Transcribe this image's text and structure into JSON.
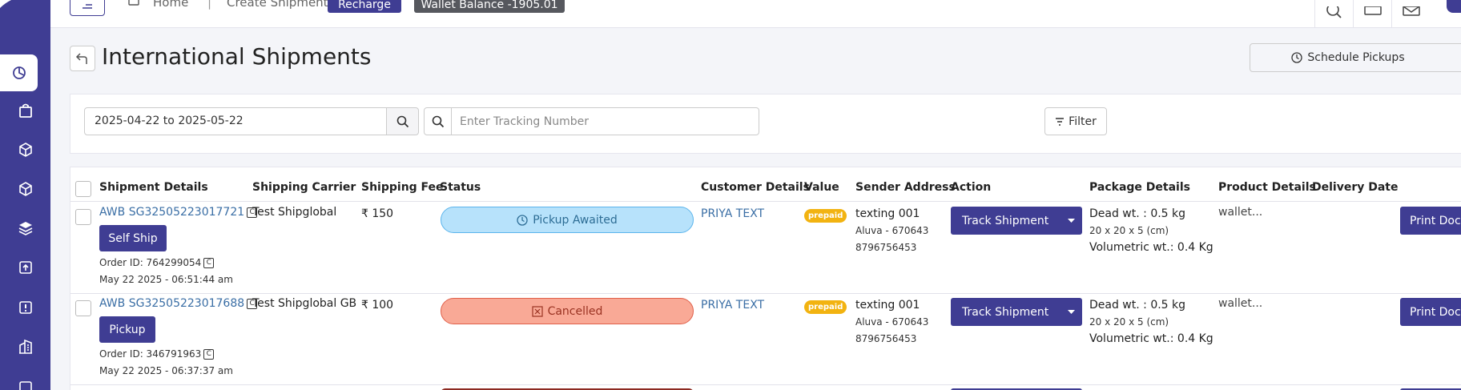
{
  "topbar": {
    "home": "Home",
    "separator": "|",
    "create_shipment": "Create Shipment",
    "recharge": "Recharge",
    "wallet_balance": "Wallet Balance -1905.01"
  },
  "page": {
    "title": "International Shipments",
    "schedule_pickups": "Schedule Pickups"
  },
  "filters": {
    "date_range": "2025-04-22 to 2025-05-22",
    "tracking_placeholder": "Enter Tracking Number",
    "filter_label": "Filter"
  },
  "table": {
    "headers": {
      "shipment": "Shipment Details",
      "carrier": "Shipping Carrier",
      "fee": "Shipping Fee",
      "status": "Status",
      "customer": "Customer Details",
      "value": "Value",
      "sender": "Sender Address",
      "action": "Action",
      "package": "Package Details",
      "product": "Product Details",
      "delivery": "Delivery Date"
    },
    "rows": [
      {
        "awb": "AWB SG32505223017721",
        "ship_btn": "Self Ship",
        "order_id": "Order ID: 764299054",
        "date": "May 22 2025 - 06:51:44 am",
        "carrier": "Test Shipglobal",
        "fee": "₹ 150",
        "status": "Pickup Awaited",
        "customer": "PRIYA TEXT",
        "value_badge": "prepaid",
        "sender_name": "texting 001",
        "sender_city": "Aluva - 670643",
        "sender_phone": "8796756453",
        "action": "Track Shipment",
        "dead_wt": "Dead wt. : 0.5 kg",
        "dims": "20 x 20 x 5 (cm)",
        "vol_wt": "Volumetric wt.: 0.4 Kg",
        "product": "wallet...",
        "print": "Print Documents"
      },
      {
        "awb": "AWB SG32505223017688",
        "ship_btn": "Pickup",
        "order_id": "Order ID: 346791963",
        "date": "May 22 2025 - 06:37:37 am",
        "carrier": "Test Shipglobal GB",
        "fee": "₹ 100",
        "status": "Cancelled",
        "customer": "PRIYA TEXT",
        "value_badge": "prepaid",
        "sender_name": "texting 001",
        "sender_city": "Aluva - 670643",
        "sender_phone": "8796756453",
        "action": "Track Shipment",
        "dead_wt": "Dead wt. : 0.5 kg",
        "dims": "20 x 20 x 5 (cm)",
        "vol_wt": "Volumetric wt.: 0.4 Kg",
        "product": "wallet...",
        "print": "Print Documents"
      }
    ]
  },
  "colors": {
    "primary": "#3f3d93",
    "awaited_bg": "#b7e2fb",
    "cancelled_bg": "#f9a996",
    "prepaid": "#f2b311",
    "link": "#3a6ea5"
  },
  "icons": {
    "sidebar": [
      "dashboard-icon",
      "bag-icon",
      "box-icon",
      "box-icon",
      "layers-icon",
      "upload-icon",
      "alert-icon",
      "building-icon",
      "wallet-icon"
    ],
    "topbar": [
      "search-icon",
      "cart-icon",
      "mail-icon"
    ]
  }
}
